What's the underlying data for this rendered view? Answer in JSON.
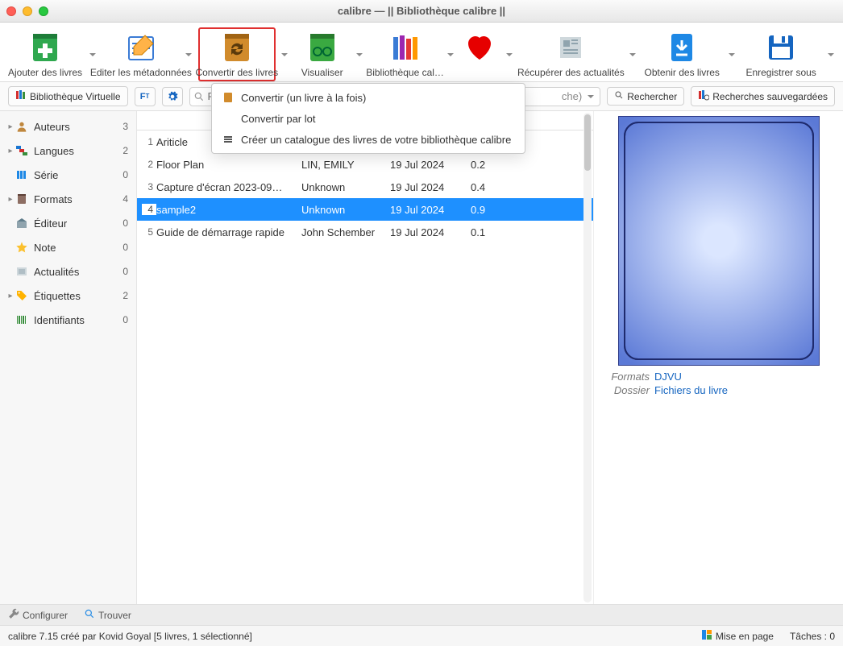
{
  "window": {
    "title": "calibre — || Bibliothèque calibre ||"
  },
  "toolbar": {
    "items": [
      {
        "id": "add",
        "label": "Ajouter des livres",
        "has_caret": true
      },
      {
        "id": "editmeta",
        "label": "Editer les métadonnées",
        "has_caret": true
      },
      {
        "id": "convert",
        "label": "Convertir des livres",
        "has_caret": true,
        "highlight": true
      },
      {
        "id": "view",
        "label": "Visualiser",
        "has_caret": true
      },
      {
        "id": "library",
        "label": "Bibliothèque cal…",
        "has_caret": true
      },
      {
        "id": "fav",
        "label": "",
        "has_caret": true
      },
      {
        "id": "news",
        "label": "Récupérer des actualités",
        "has_caret": true
      },
      {
        "id": "get",
        "label": "Obtenir des livres",
        "has_caret": true
      },
      {
        "id": "save",
        "label": "Enregistrer sous",
        "has_caret": true
      }
    ]
  },
  "secondary": {
    "biblio": "Bibliothèque Virtuelle",
    "search_placeholder": "Recherche",
    "combo_value": "che)",
    "search_btn": "Rechercher",
    "saved": "Recherches sauvegardées"
  },
  "sidebar": {
    "items": [
      {
        "id": "auteurs",
        "label": "Auteurs",
        "count": "3",
        "caret": true
      },
      {
        "id": "langues",
        "label": "Langues",
        "count": "2",
        "caret": true
      },
      {
        "id": "serie",
        "label": "Série",
        "count": "0",
        "caret": false
      },
      {
        "id": "formats",
        "label": "Formats",
        "count": "4",
        "caret": true
      },
      {
        "id": "editeur",
        "label": "Éditeur",
        "count": "0",
        "caret": false
      },
      {
        "id": "note",
        "label": "Note",
        "count": "0",
        "caret": false
      },
      {
        "id": "actualites",
        "label": "Actualités",
        "count": "0",
        "caret": false
      },
      {
        "id": "etiquettes",
        "label": "Étiquettes",
        "count": "2",
        "caret": true
      },
      {
        "id": "identifiants",
        "label": "Identifiants",
        "count": "0",
        "caret": false
      }
    ]
  },
  "books": {
    "rows": [
      {
        "n": "1",
        "title": "Ariticle",
        "author": "",
        "date": "",
        "size": ""
      },
      {
        "n": "2",
        "title": "Floor Plan",
        "author": "LIN, EMILY",
        "date": "19 Jul 2024",
        "size": "0.2"
      },
      {
        "n": "3",
        "title": "Capture d'écran 2023-09…",
        "author": "Unknown",
        "date": "19 Jul 2024",
        "size": "0.4"
      },
      {
        "n": "4",
        "title": "sample2",
        "author": "Unknown",
        "date": "19 Jul 2024",
        "size": "0.9",
        "selected": true
      },
      {
        "n": "5",
        "title": "Guide de démarrage rapide",
        "author": "John Schember",
        "date": "19 Jul 2024",
        "size": "0.1"
      }
    ]
  },
  "details": {
    "formats_label": "Formats",
    "formats_value": "DJVU",
    "dossier_label": "Dossier",
    "dossier_value": "Fichiers du livre"
  },
  "menu": {
    "items": [
      "Convertir (un livre à la fois)",
      "Convertir par lot",
      "Créer un catalogue des livres de votre bibliothèque calibre"
    ]
  },
  "bottom": {
    "configurer": "Configurer",
    "trouver": "Trouver"
  },
  "status": {
    "left": "calibre 7.15 créé par Kovid Goyal   [5 livres, 1 sélectionné]",
    "mise": "Mise en page",
    "taches": "Tâches : 0"
  }
}
